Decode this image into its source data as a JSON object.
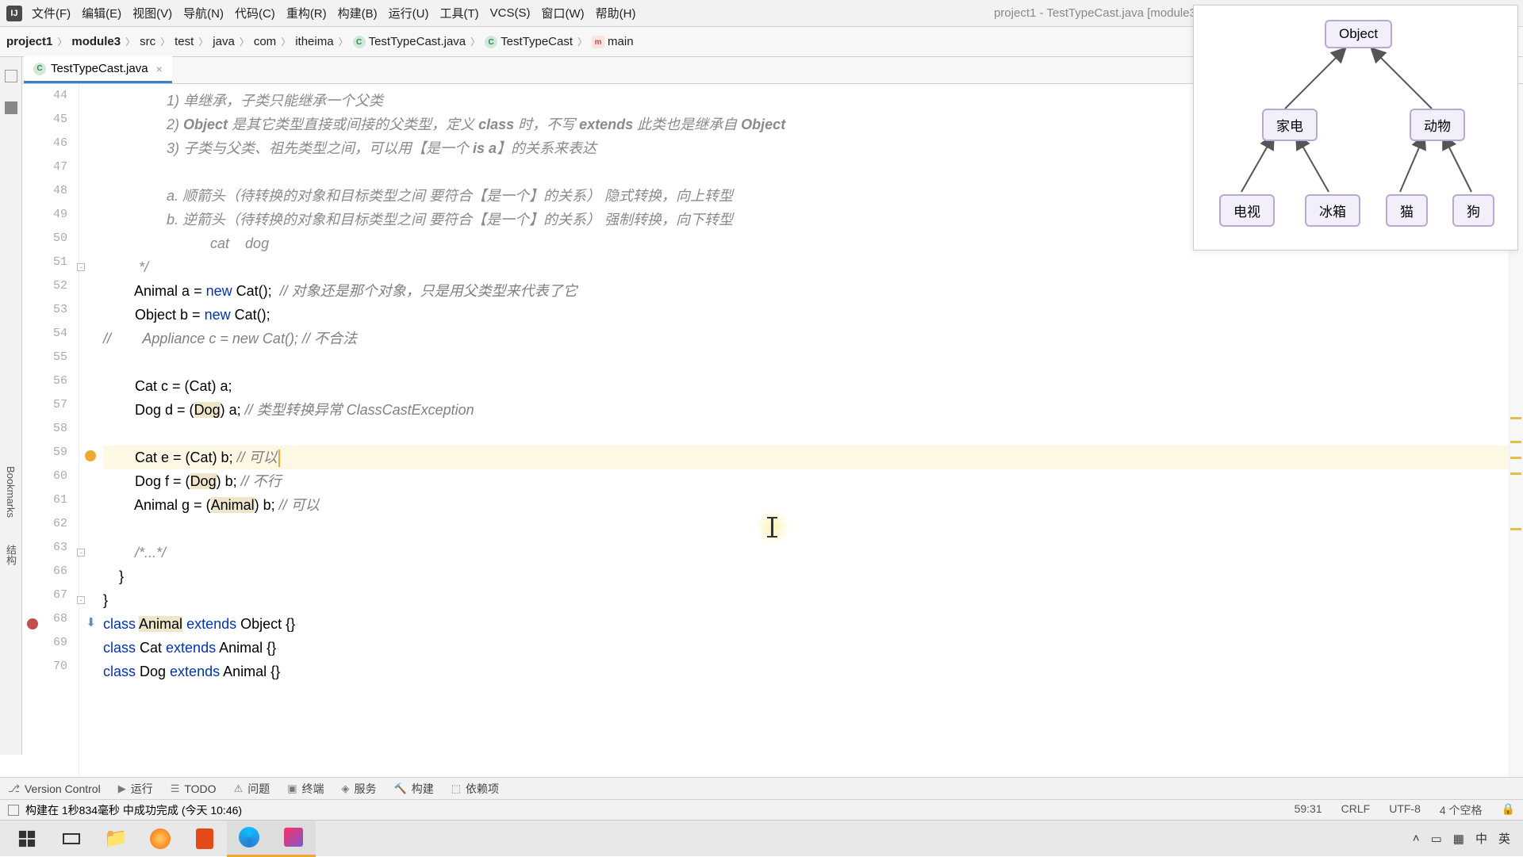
{
  "window": {
    "title": "project1 - TestTypeCast.java [module3]"
  },
  "menu": {
    "items": [
      "文件(F)",
      "编辑(E)",
      "视图(V)",
      "导航(N)",
      "代码(C)",
      "重构(R)",
      "构建(B)",
      "运行(U)",
      "工具(T)",
      "VCS(S)",
      "窗口(W)",
      "帮助(H)"
    ]
  },
  "breadcrumbs": {
    "items": [
      "project1",
      "module3",
      "src",
      "test",
      "java",
      "com",
      "itheima",
      "TestTypeCast.java",
      "TestTypeCast",
      "main"
    ]
  },
  "tab": {
    "label": "TestTypeCast.java"
  },
  "sidebar": {
    "labels": [
      "Bookmarks",
      "结构"
    ]
  },
  "diagram": {
    "nodes": {
      "root": "Object",
      "l1a": "家电",
      "l1b": "动物",
      "l2a": "电视",
      "l2b": "冰箱",
      "l2c": "猫",
      "l2d": "狗"
    }
  },
  "code": {
    "lines": [
      {
        "n": 44,
        "html": "                <span class='c-comment'>1) 单继承，子类只能继承一个父类</span>"
      },
      {
        "n": 45,
        "html": "                <span class='c-comment'>2) <span class='c-bold'>Object</span> 是其它类型直接或间接的父类型，定义 <span class='c-bold'>class</span> 时，不写 <span class='c-bold'>extends</span> 此类也是继承自 <span class='c-bold'>Object</span></span>"
      },
      {
        "n": 46,
        "html": "                <span class='c-comment'>3) 子类与父类、祖先类型之间，可以用【是一个 <span class='c-bold'>is a</span>】的关系来表达</span>"
      },
      {
        "n": 47,
        "html": ""
      },
      {
        "n": 48,
        "html": "                <span class='c-comment'>a. 顺箭头（待转换的对象和目标类型之间 要符合【是一个】的关系） 隐式转换，向上转型</span>"
      },
      {
        "n": 49,
        "html": "                <span class='c-comment'>b. 逆箭头（待转换的对象和目标类型之间 要符合【是一个】的关系） 强制转换，向下转型</span>"
      },
      {
        "n": 50,
        "html": "                           <span class='c-comment'>cat    dog</span>"
      },
      {
        "n": 51,
        "html": "         <span class='c-comment'>*/</span>",
        "fold": true
      },
      {
        "n": 52,
        "html": "        Animal <span class='c-type'>a</span> = <span class='c-kw'>new</span> Cat();  <span class='c-ital'>// 对象还是那个对象，只是用父类型来代表了它</span>"
      },
      {
        "n": 53,
        "html": "        Object <span class='c-type'>b</span> = <span class='c-kw'>new</span> Cat();"
      },
      {
        "n": 54,
        "html": "<span class='c-ital'>//        Appliance c = new Cat(); // 不合法</span>"
      },
      {
        "n": 55,
        "html": ""
      },
      {
        "n": 56,
        "html": "        Cat <span class='c-type'>c</span> = (Cat) a;"
      },
      {
        "n": 57,
        "html": "        Dog <span class='c-type'>d</span> = (<span class='c-hlword'>Dog</span>) a; <span class='c-ital'>// 类型转换异常 ClassCastException</span>"
      },
      {
        "n": 58,
        "html": ""
      },
      {
        "n": 59,
        "html": "        Cat <span class='c-type'>e</span> = (Cat) b; <span class='c-ital'>// 可以</span><span class='c-cursor'></span>",
        "hl": true,
        "bulb": true
      },
      {
        "n": 60,
        "html": "        Dog <span class='c-type'>f</span> = (<span class='c-hlword'>Dog</span>) b; <span class='c-ital'>// 不行</span>"
      },
      {
        "n": 61,
        "html": "        Animal <span class='c-type'>g</span> = (<span class='c-hlword'>Animal</span>) b; <span class='c-ital'>// 可以</span>"
      },
      {
        "n": 62,
        "html": ""
      },
      {
        "n": 63,
        "html": "        <span class='c-comment'>/*...*/</span>",
        "fold": true
      },
      {
        "n": 66,
        "html": "    }"
      },
      {
        "n": 67,
        "html": "}",
        "fold": true
      },
      {
        "n": 68,
        "html": "<span class='c-kw'>class</span> <span class='c-hlword'>Animal</span> <span class='c-kw'>extends</span> Object {}",
        "break": true,
        "arrow": true
      },
      {
        "n": 69,
        "html": "<span class='c-kw'>class</span> Cat <span class='c-kw'>extends</span> Animal {}"
      },
      {
        "n": 70,
        "html": "<span class='c-kw'>class</span> Dog <span class='c-kw'>extends</span> Animal {}"
      }
    ]
  },
  "toolstrip": {
    "items": [
      "Version Control",
      "运行",
      "TODO",
      "问题",
      "终端",
      "服务",
      "构建",
      "依赖项"
    ]
  },
  "status": {
    "msg": "构建在 1秒834毫秒 中成功完成 (今天 10:46)",
    "pos": "59:31",
    "eol": "CRLF",
    "enc": "UTF-8",
    "indent": "4 个空格"
  },
  "tray": {
    "ime1": "中",
    "ime2": "英"
  }
}
